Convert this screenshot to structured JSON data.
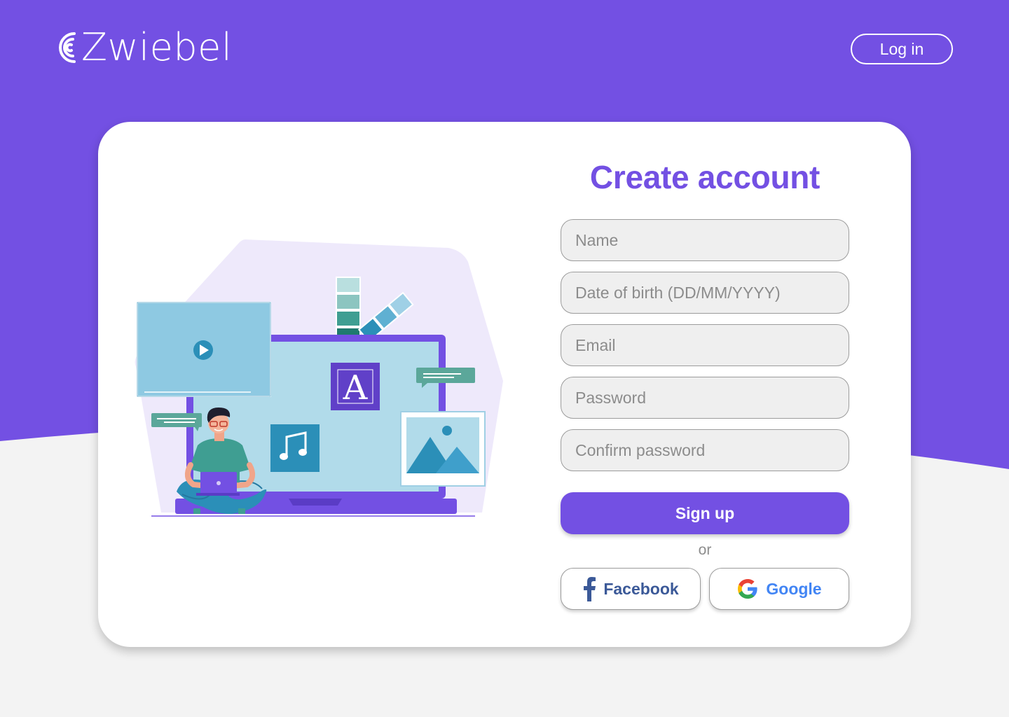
{
  "brand": {
    "name": "Zwiebel",
    "primary_color": "#7350e3",
    "background_color": "#f3f3f3"
  },
  "header": {
    "login_label": "Log in"
  },
  "form": {
    "title": "Create account",
    "fields": [
      {
        "placeholder": "Name",
        "value": ""
      },
      {
        "placeholder": "Date of birth (DD/MM/YYYY)",
        "value": ""
      },
      {
        "placeholder": "Email",
        "value": ""
      },
      {
        "placeholder": "Password",
        "value": ""
      },
      {
        "placeholder": "Confirm password",
        "value": ""
      }
    ],
    "submit_label": "Sign up",
    "divider_text": "or",
    "social": [
      {
        "label": "Facebook",
        "icon": "facebook-icon",
        "color": "#3b5998"
      },
      {
        "label": "Google",
        "icon": "google-icon",
        "color": "#4285f4"
      }
    ]
  },
  "illustration": {
    "icons": [
      "play-icon",
      "letter-a-icon",
      "music-note-icon",
      "image-icon",
      "color-swatch-icon"
    ],
    "letter": "A"
  }
}
